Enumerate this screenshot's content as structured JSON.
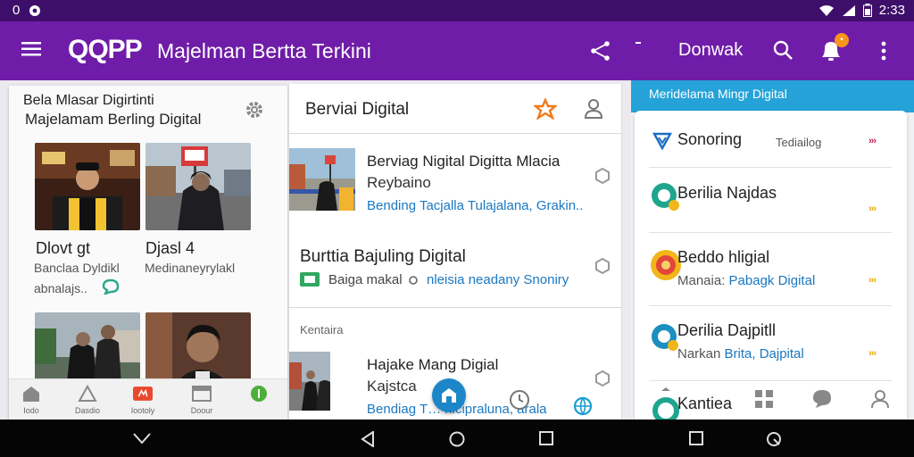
{
  "status": {
    "left_text": "0",
    "time": "2:33"
  },
  "appbar": {
    "logo": "QQPP",
    "title": "Majelman Bertta Terkini",
    "action_label": "Donwak",
    "badge_glyph": "•",
    "icons": [
      "menu-icon",
      "share-icon",
      "search-icon",
      "bell-icon",
      "more-vert-icon"
    ]
  },
  "left_panel": {
    "header_line1": "Bela Mlasar Digirtinti",
    "header_line2": "Majelamam Berling Digital",
    "tiles": [
      {
        "name": "Dlovt gt",
        "sub1": "Banclaa Dyldikl",
        "sub2": "abnalajs.."
      },
      {
        "name": "Djasl 4",
        "sub1": "Medinaneyrylakl",
        "sub2": ""
      },
      {
        "name": "",
        "sub1": "",
        "sub2": ""
      },
      {
        "name": "",
        "sub1": "",
        "sub2": ""
      }
    ],
    "bottom_tabs": [
      {
        "label": "Iodo"
      },
      {
        "label": "Dasdio"
      },
      {
        "label": "Iootoly"
      },
      {
        "label": "Doour"
      },
      {
        "label": ""
      }
    ]
  },
  "mid_panel": {
    "header": "Berviai Digital",
    "articles": [
      {
        "title": "Berviag Nigital Digitta Mlacia",
        "subtitle": "Reybaino",
        "link": "Bending Tacjalla Tulajalana, Grakin.."
      },
      {
        "title": "Burttia Bajuling Digital",
        "meta_prefix": "Baiga makal",
        "link": "nleisia neadany Snoniry"
      },
      {
        "title": "Hajake Mang Digial",
        "subtitle": "Kajstca",
        "link": "Bendiag T… nicipraluna, arala"
      }
    ],
    "section_label": "Kentaira"
  },
  "right_panel": {
    "band_label": "Meridelama Mingr Digital",
    "items": [
      {
        "title": "Sonoring",
        "sub_plain": "Tediailog",
        "sub_link": "",
        "chevron_color": "#c2185b"
      },
      {
        "title": "Berilia Najdas",
        "sub_plain": "",
        "sub_link": "",
        "chevron_color": "#e6a800"
      },
      {
        "title": "Beddo hligial",
        "sub_plain": "Manaia:",
        "sub_link": "Pabagk Digital",
        "chevron_color": "#e6a800"
      },
      {
        "title": "Derilia Dajpitll",
        "sub_plain": "Narkan",
        "sub_link": "Brita, Dajpital",
        "chevron_color": "#e6a800"
      },
      {
        "title": "Kantiea",
        "sub_plain": "",
        "sub_link": "",
        "chevron_color": "#e6a800"
      }
    ]
  },
  "colors": {
    "status_bar": "#3e0f6a",
    "app_bar": "#6f1da8",
    "accent_blue": "#25a3d8",
    "link": "#1a78c2"
  }
}
